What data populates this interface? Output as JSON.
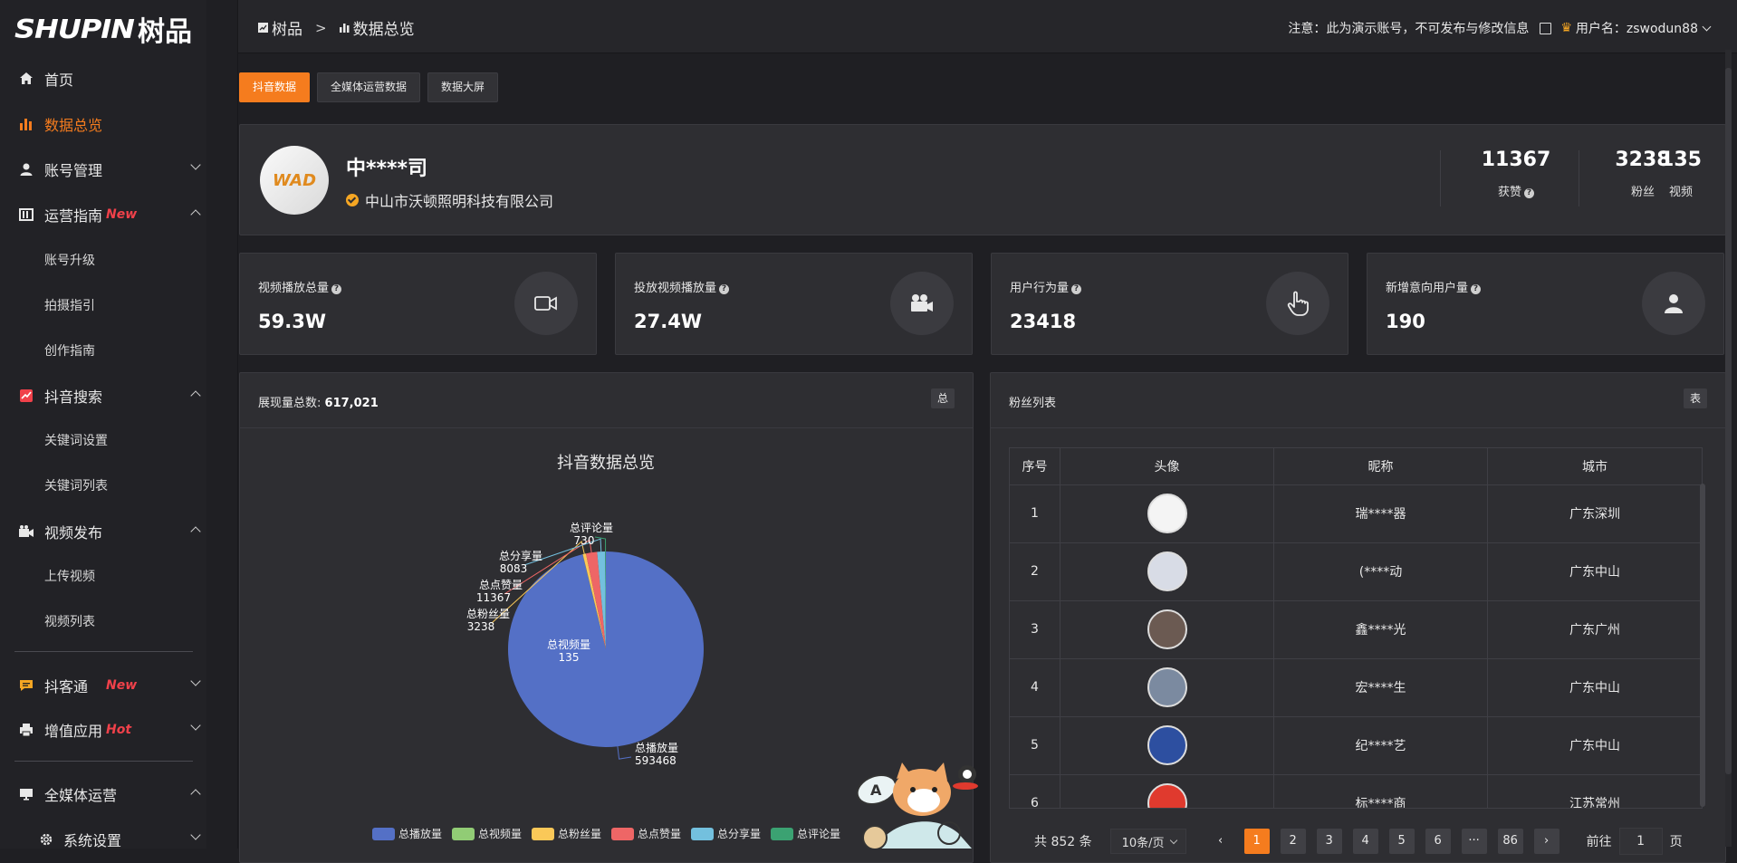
{
  "brand": {
    "logo_word": "SHUPIN",
    "logo_cn": "树品"
  },
  "sidebar": {
    "items": [
      {
        "label": "首页",
        "icon": "home-icon"
      },
      {
        "label": "数据总览",
        "icon": "bar-chart-icon",
        "active": true
      },
      {
        "label": "账号管理",
        "icon": "user-icon"
      },
      {
        "label": "运营指南",
        "icon": "book-icon",
        "tag": "New"
      },
      {
        "label": "账号升级"
      },
      {
        "label": "拍摄指引"
      },
      {
        "label": "创作指南"
      },
      {
        "label": "抖音搜索",
        "icon": "trend-icon"
      },
      {
        "label": "关键词设置"
      },
      {
        "label": "关键词列表"
      },
      {
        "label": "视频发布",
        "icon": "camera-icon"
      },
      {
        "label": "上传视频"
      },
      {
        "label": "视频列表"
      },
      {
        "label": "抖客通",
        "icon": "chat-icon",
        "tag": "New"
      },
      {
        "label": "增值应用",
        "icon": "printer-icon",
        "tag": "Hot"
      },
      {
        "label": "全媒体运营",
        "icon": "monitor-icon"
      },
      {
        "label": "系统设置",
        "icon": "gear-icon"
      }
    ]
  },
  "header": {
    "breadcrumb": [
      "树品",
      "数据总览"
    ],
    "breadcrumb_sep": ">",
    "notice": "注意：此为演示账号，不可发布与修改信息",
    "username": "用户名：zswodun88"
  },
  "tabs": [
    "抖音数据",
    "全媒体运营数据",
    "数据大屏"
  ],
  "profile": {
    "name": "中****司",
    "company": "中山市沃顿照明科技有限公司",
    "avatar_text": "WAD",
    "stats": [
      {
        "value": "11367",
        "label": "获赞"
      },
      {
        "value": "3238",
        "label": "粉丝"
      },
      {
        "value": "135",
        "label": "视频"
      }
    ]
  },
  "cards": [
    {
      "title": "视频播放总量",
      "value": "59.3W",
      "icon": "video-icon"
    },
    {
      "title": "投放视频播放量",
      "value": "27.4W",
      "icon": "movie-camera-icon"
    },
    {
      "title": "用户行为量",
      "value": "23418",
      "icon": "pointer-hand-icon"
    },
    {
      "title": "新增意向用户量",
      "value": "190",
      "icon": "person-icon"
    }
  ],
  "chart_panel": {
    "title_prefix": "展现量总数:",
    "total": "617,021",
    "badge": "总"
  },
  "chart_data": {
    "type": "pie",
    "title": "抖音数据总览",
    "series": [
      {
        "name": "总播放量",
        "value": 593468,
        "color": "#5470c6"
      },
      {
        "name": "总视频量",
        "value": 135,
        "color": "#91cc75"
      },
      {
        "name": "总粉丝量",
        "value": 3238,
        "color": "#fac858"
      },
      {
        "name": "总点赞量",
        "value": 11367,
        "color": "#ee6666"
      },
      {
        "name": "总分享量",
        "value": 8083,
        "color": "#73c0de"
      },
      {
        "name": "总评论量",
        "value": 730,
        "color": "#3ba272"
      }
    ],
    "legend": "bottom"
  },
  "fans": {
    "title": "粉丝列表",
    "badge": "表",
    "columns": [
      "序号",
      "头像",
      "昵称",
      "城市"
    ],
    "rows": [
      {
        "no": "1",
        "nick": "瑞****器",
        "city": "广东深圳",
        "avatar_color": "#f4f4f4"
      },
      {
        "no": "2",
        "nick": "(****动",
        "city": "广东中山",
        "avatar_color": "#d8dce6"
      },
      {
        "no": "3",
        "nick": "鑫****光",
        "city": "广东广州",
        "avatar_color": "#6b5a52"
      },
      {
        "no": "4",
        "nick": "宏****生",
        "city": "广东中山",
        "avatar_color": "#7b8aa0"
      },
      {
        "no": "5",
        "nick": "纪****艺",
        "city": "广东中山",
        "avatar_color": "#2d4fa0"
      },
      {
        "no": "6",
        "nick": "标****商",
        "city": "江苏常州",
        "avatar_color": "#e03a2e"
      }
    ],
    "pager": {
      "total": "共 852 条",
      "size": "10条/页",
      "pages": [
        "1",
        "2",
        "3",
        "4",
        "5",
        "6",
        "···",
        "86"
      ],
      "goto_prefix": "前往",
      "goto_value": "1",
      "goto_suffix": "页"
    }
  },
  "mascot": {
    "bubble": "A"
  }
}
